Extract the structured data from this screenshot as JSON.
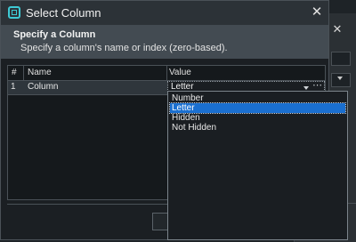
{
  "dialog": {
    "title": "Select Column",
    "header_title": "Specify a Column",
    "header_subtitle": "Specify a column's name or index (zero-based)."
  },
  "grid": {
    "columns": [
      "#",
      "Name",
      "Value"
    ],
    "rows": [
      {
        "index": "1",
        "name": "Column",
        "value": "Letter"
      }
    ],
    "more_button": "⋯"
  },
  "dropdown": {
    "options": [
      "Number",
      "Letter",
      "Hidden",
      "Not Hidden"
    ],
    "selected": "Letter"
  },
  "icons": {
    "close": "✕",
    "background_close": "✕"
  },
  "colors": {
    "accent": "#1a6fd0",
    "app_icon": "#3ec9d4"
  }
}
